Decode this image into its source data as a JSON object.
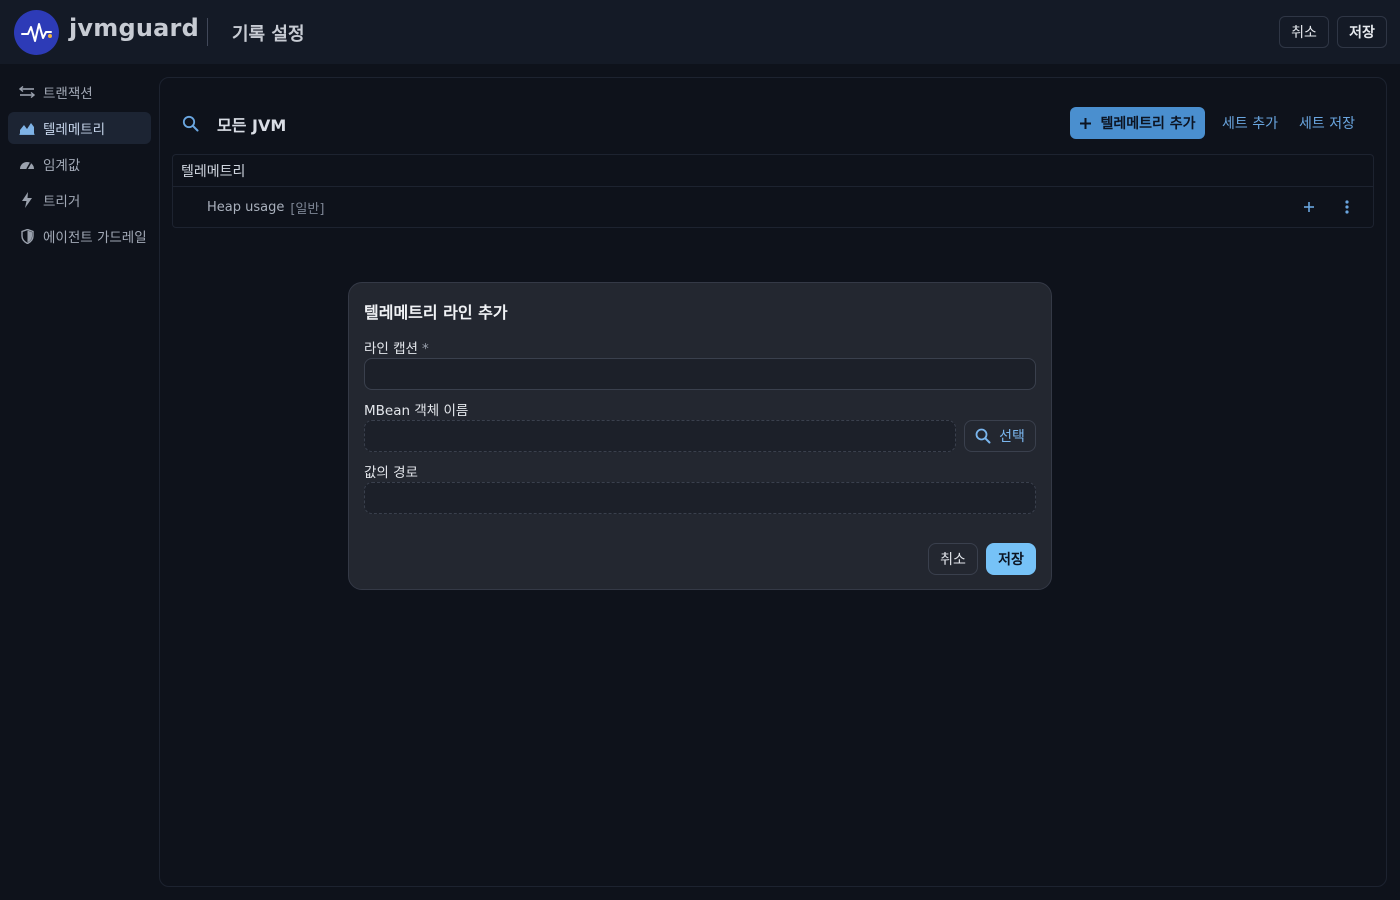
{
  "header": {
    "brand": "jvmguard",
    "title": "기록 설정",
    "cancel_label": "취소",
    "save_label": "저장"
  },
  "sidebar": {
    "items": [
      {
        "label": "트랜잭션",
        "icon": "transaction-arrows-icon",
        "active": false
      },
      {
        "label": "텔레메트리",
        "icon": "area-chart-icon",
        "active": true
      },
      {
        "label": "임계값",
        "icon": "gauge-icon",
        "active": false
      },
      {
        "label": "트리거",
        "icon": "lightning-icon",
        "active": false
      },
      {
        "label": "에이전트 가드레일",
        "icon": "shield-icon",
        "active": false
      }
    ]
  },
  "main": {
    "scope_label": "모든 JVM",
    "add_telemetry_label": "텔레메트리 추가",
    "add_set_label": "세트 추가",
    "save_set_label": "세트 저장",
    "table": {
      "header": "텔레메트리",
      "rows": [
        {
          "name": "Heap usage",
          "tag": "[일반]"
        }
      ]
    }
  },
  "dialog": {
    "title": "텔레메트리 라인 추가",
    "caption_label": "라인 캡션",
    "caption_required": "*",
    "caption_value": "",
    "mbean_label": "MBean 객체 이름",
    "mbean_value": "",
    "select_label": "선택",
    "path_label": "값의 경로",
    "path_value": "",
    "cancel_label": "취소",
    "save_label": "저장"
  },
  "colors": {
    "accent": "#4a8fcf",
    "save_accent": "#76c2f7",
    "logo": "#2d3bb7"
  }
}
